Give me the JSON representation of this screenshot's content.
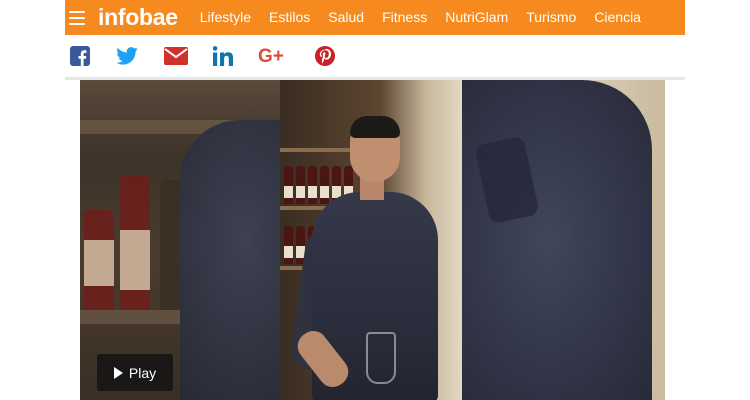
{
  "header": {
    "logo": "infobae",
    "menu_icon": "hamburger-menu-icon",
    "nav": [
      "Lifestyle",
      "Estilos",
      "Salud",
      "Fitness",
      "NutriGlam",
      "Turismo",
      "Ciencia"
    ],
    "background_color": "#f68a1f"
  },
  "share": {
    "icons": [
      "facebook-icon",
      "twitter-icon",
      "email-icon",
      "linkedin-icon",
      "google-plus-icon",
      "pinterest-icon"
    ],
    "colors": {
      "facebook": "#3b5998",
      "twitter": "#1da1f2",
      "email": "#d0312d",
      "linkedin": "#0e76a8",
      "google_plus": "#dd4b39",
      "pinterest": "#cb2027"
    },
    "google_plus_text": "G+"
  },
  "video": {
    "play_label": "Play",
    "play_icon": "play-triangle-icon"
  }
}
